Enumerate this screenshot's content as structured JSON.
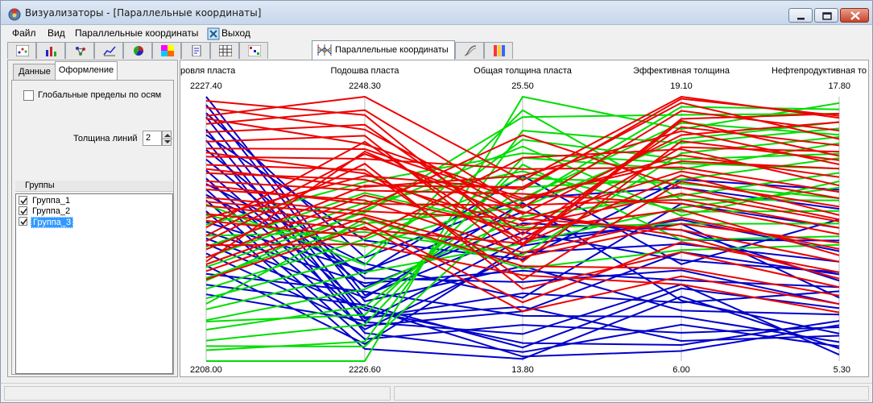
{
  "window": {
    "title": "Визуализаторы - [Параллельные координаты]"
  },
  "menu": {
    "file": "Файл",
    "view": "Вид",
    "parallel": "Параллельные координаты",
    "exit": "Выход"
  },
  "toolbar": {
    "active_tab_label": "Параллельные координаты",
    "icons": [
      "scatter-plot-icon",
      "bar-chart-icon",
      "cluster-icon",
      "line-chart-icon",
      "pie-icon",
      "heatmap-icon",
      "document-icon",
      "grid-table-icon",
      "matrix-icon",
      "parallel-coordinates-icon",
      "curves-icon",
      "color-scale-icon"
    ]
  },
  "panel": {
    "tabs": [
      "Данные",
      "Оформление"
    ],
    "global_limits_label": "Глобальные пределы по осям",
    "line_width_label": "Толщина линий",
    "line_width_value": "2",
    "groups_title": "Группы",
    "groups": [
      {
        "label": "Группа_1",
        "checked": true,
        "selected": false
      },
      {
        "label": "Группа_2",
        "checked": true,
        "selected": false
      },
      {
        "label": "Группа_3",
        "checked": true,
        "selected": true
      }
    ]
  },
  "colors": {
    "group_1": "#0000cc",
    "group_2": "#00dd00",
    "group_3": "#ee0000",
    "axis": "#bbbbbb"
  },
  "chart_data": {
    "type": "parallel-coordinates",
    "axes": [
      {
        "label": "ровля пласта",
        "max": 2227.4,
        "min": 2208.0,
        "max_label": "2227.40",
        "min_label": "2208.00"
      },
      {
        "label": "Подошва пласта",
        "max": 2248.3,
        "min": 2226.6,
        "max_label": "2248.30",
        "min_label": "2226.60"
      },
      {
        "label": "Общая толщина пласта",
        "max": 25.5,
        "min": 13.8,
        "max_label": "25.50",
        "min_label": "13.80"
      },
      {
        "label": "Эффективная толщина",
        "max": 19.1,
        "min": 6.0,
        "max_label": "19.10",
        "min_label": "6.00"
      },
      {
        "label": "Нефтепродуктивная то",
        "max": 17.8,
        "min": 5.3,
        "max_label": "17.80",
        "min_label": "5.30"
      }
    ],
    "series": [
      {
        "name": "Группа_1",
        "lines": [
          [
            2227.4,
            2232.0,
            19.5,
            11.0,
            9.5
          ],
          [
            2226.8,
            2231.5,
            18.0,
            8.5,
            7.5
          ],
          [
            2225.9,
            2230.2,
            16.2,
            7.0,
            6.5
          ],
          [
            2225.0,
            2229.8,
            15.0,
            9.8,
            5.6
          ],
          [
            2224.2,
            2228.9,
            14.2,
            7.8,
            6.0
          ],
          [
            2223.5,
            2233.4,
            17.3,
            10.5,
            8.0
          ],
          [
            2222.8,
            2232.7,
            19.9,
            12.5,
            9.1
          ],
          [
            2222.0,
            2231.0,
            14.0,
            6.5,
            7.0
          ],
          [
            2221.4,
            2230.1,
            16.8,
            8.9,
            8.6
          ],
          [
            2220.6,
            2229.2,
            18.6,
            11.8,
            10.0
          ],
          [
            2219.8,
            2228.4,
            15.4,
            7.4,
            6.9
          ],
          [
            2219.0,
            2227.6,
            13.9,
            9.2,
            5.9
          ],
          [
            2218.2,
            2234.0,
            20.4,
            12.0,
            11.0
          ],
          [
            2217.5,
            2233.0,
            17.8,
            10.0,
            8.8
          ],
          [
            2216.6,
            2230.8,
            14.6,
            6.8,
            7.2
          ],
          [
            2215.9,
            2229.5,
            16.0,
            11.4,
            9.4
          ],
          [
            2215.0,
            2228.0,
            18.9,
            13.0,
            10.5
          ],
          [
            2214.4,
            2232.3,
            15.8,
            8.2,
            6.2
          ],
          [
            2213.6,
            2231.2,
            14.4,
            9.6,
            7.8
          ],
          [
            2212.9,
            2229.9,
            19.2,
            12.8,
            8.3
          ],
          [
            2226.2,
            2235.1,
            21.0,
            14.6,
            12.5
          ],
          [
            2221.0,
            2234.6,
            16.6,
            13.8,
            11.6
          ],
          [
            2217.0,
            2231.8,
            20.8,
            9.0,
            6.6
          ],
          [
            2224.6,
            2236.5,
            18.3,
            15.0,
            13.4
          ],
          [
            2220.2,
            2233.8,
            22.0,
            10.8,
            12.0
          ]
        ]
      },
      {
        "name": "Группа_2",
        "lines": [
          [
            2208.0,
            2226.6,
            25.5,
            17.5,
            17.5
          ],
          [
            2208.8,
            2228.2,
            24.0,
            16.8,
            16.3
          ],
          [
            2209.5,
            2229.6,
            22.8,
            15.5,
            15.6
          ],
          [
            2210.3,
            2231.1,
            21.5,
            15.0,
            14.9
          ],
          [
            2211.0,
            2232.5,
            20.2,
            14.2,
            14.2
          ],
          [
            2211.8,
            2233.9,
            19.0,
            13.6,
            13.5
          ],
          [
            2212.6,
            2235.2,
            23.6,
            16.0,
            15.1
          ],
          [
            2213.3,
            2236.6,
            21.9,
            14.8,
            13.0
          ],
          [
            2214.1,
            2237.9,
            20.6,
            17.0,
            16.6
          ],
          [
            2214.9,
            2238.8,
            24.6,
            18.2,
            17.0
          ],
          [
            2215.6,
            2239.6,
            22.2,
            13.4,
            12.4
          ],
          [
            2216.4,
            2240.4,
            19.7,
            12.8,
            11.8
          ],
          [
            2217.2,
            2237.2,
            18.5,
            16.3,
            15.9
          ],
          [
            2218.0,
            2241.3,
            23.0,
            15.8,
            14.4
          ],
          [
            2218.7,
            2236.0,
            21.0,
            17.8,
            16.0
          ],
          [
            2219.5,
            2234.5,
            24.9,
            14.0,
            12.9
          ],
          [
            2210.9,
            2230.4,
            22.5,
            12.0,
            11.2
          ],
          [
            2212.2,
            2238.3,
            17.9,
            11.5,
            10.8
          ],
          [
            2209.1,
            2227.8,
            20.9,
            18.6,
            17.2
          ],
          [
            2213.9,
            2239.0,
            23.3,
            13.2,
            13.8
          ]
        ]
      },
      {
        "name": "Группа_3",
        "lines": [
          [
            2226.0,
            2248.3,
            21.8,
            19.1,
            16.8
          ],
          [
            2225.4,
            2247.2,
            20.6,
            18.4,
            16.2
          ],
          [
            2224.8,
            2246.0,
            19.4,
            17.6,
            15.5
          ],
          [
            2224.1,
            2245.1,
            18.2,
            16.9,
            14.8
          ],
          [
            2223.6,
            2244.0,
            20.9,
            16.2,
            14.0
          ],
          [
            2223.0,
            2243.2,
            22.3,
            15.6,
            13.3
          ],
          [
            2222.4,
            2242.3,
            17.4,
            14.9,
            12.6
          ],
          [
            2221.8,
            2241.5,
            19.8,
            14.3,
            11.9
          ],
          [
            2221.2,
            2240.6,
            21.2,
            13.8,
            11.3
          ],
          [
            2220.6,
            2239.8,
            18.6,
            13.1,
            10.6
          ],
          [
            2220.0,
            2238.9,
            20.1,
            12.5,
            10.0
          ],
          [
            2219.4,
            2238.0,
            16.4,
            11.9,
            9.5
          ],
          [
            2218.8,
            2237.4,
            19.0,
            15.2,
            12.2
          ],
          [
            2218.3,
            2236.8,
            22.8,
            16.5,
            13.6
          ],
          [
            2217.8,
            2244.6,
            18.9,
            17.9,
            15.0
          ],
          [
            2217.2,
            2243.6,
            20.4,
            12.2,
            9.2
          ],
          [
            2216.8,
            2242.8,
            17.0,
            11.4,
            8.8
          ],
          [
            2216.2,
            2241.0,
            21.5,
            18.8,
            15.8
          ],
          [
            2215.6,
            2240.2,
            19.6,
            13.5,
            10.3
          ],
          [
            2215.1,
            2239.2,
            23.8,
            14.6,
            12.0
          ],
          [
            2214.6,
            2238.4,
            18.0,
            10.6,
            8.4
          ],
          [
            2214.0,
            2237.6,
            16.0,
            10.2,
            8.0
          ],
          [
            2226.6,
            2245.6,
            20.3,
            17.2,
            16.6
          ],
          [
            2225.8,
            2244.4,
            21.0,
            15.9,
            14.4
          ],
          [
            2223.3,
            2242.0,
            19.2,
            16.6,
            15.2
          ],
          [
            2222.1,
            2240.9,
            22.0,
            17.4,
            14.6
          ],
          [
            2220.9,
            2239.5,
            20.7,
            14.0,
            11.6
          ],
          [
            2219.7,
            2238.6,
            18.4,
            12.8,
            10.9
          ],
          [
            2218.5,
            2241.8,
            21.4,
            19.0,
            16.9
          ],
          [
            2227.1,
            2246.8,
            19.0,
            18.0,
            17.0
          ],
          [
            2216.5,
            2236.2,
            17.6,
            9.8,
            7.6
          ],
          [
            2215.3,
            2243.8,
            20.0,
            15.4,
            13.0
          ]
        ]
      }
    ]
  }
}
